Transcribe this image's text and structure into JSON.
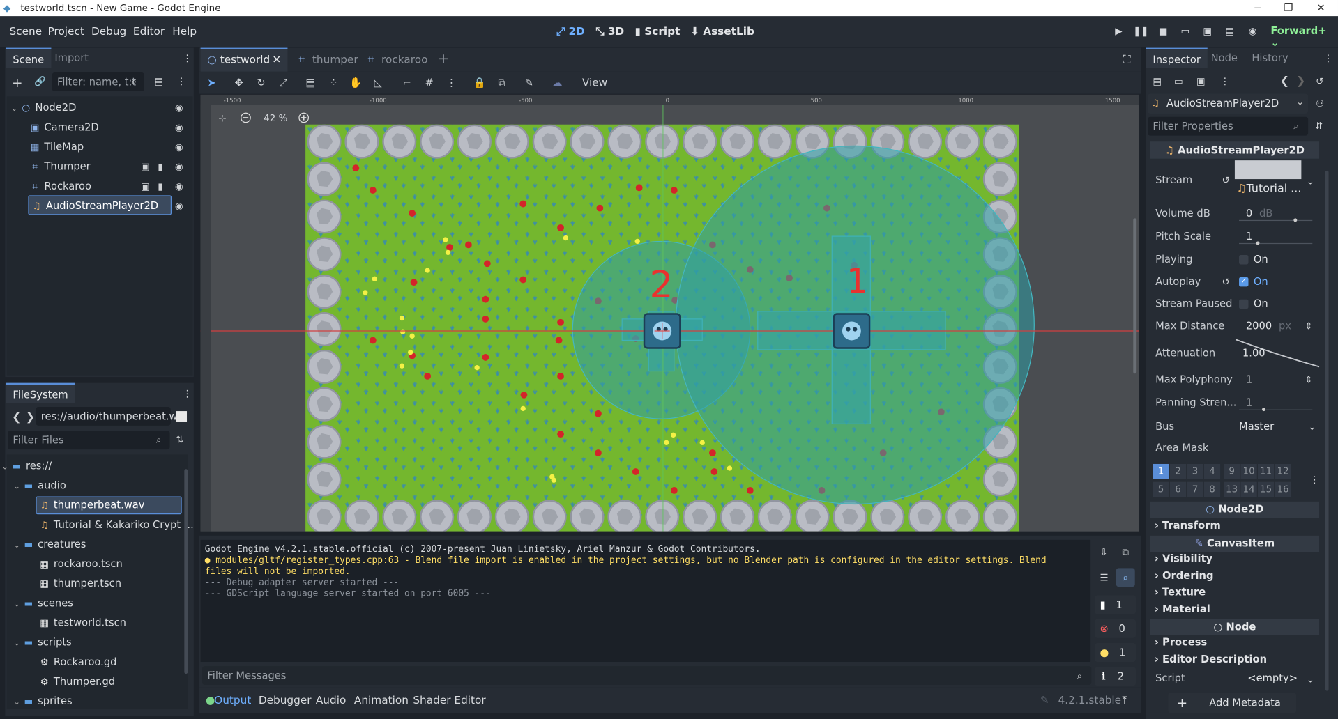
{
  "window": {
    "title": "testworld.tscn - New Game - Godot Engine",
    "minimize": "−",
    "maximize": "❐",
    "close": "✕"
  },
  "menu": [
    "Scene",
    "Project",
    "Debug",
    "Editor",
    "Help"
  ],
  "workspaces": {
    "w2d": "2D",
    "w3d": "3D",
    "script": "Script",
    "assetlib": "AssetLib"
  },
  "renderer": "Forward+",
  "scene_dock": {
    "tabs": [
      "Scene",
      "Import"
    ],
    "filter_placeholder": "Filter: name, t:t",
    "nodes": [
      {
        "label": "Node2D",
        "icon": "○"
      },
      {
        "label": "Camera2D",
        "icon": "▣"
      },
      {
        "label": "TileMap",
        "icon": "▦"
      },
      {
        "label": "Thumper",
        "icon": "⌗"
      },
      {
        "label": "Rockaroo",
        "icon": "⌗"
      },
      {
        "label": "AudioStreamPlayer2D",
        "icon": "♫"
      }
    ]
  },
  "filesystem": {
    "tab": "FileSystem",
    "path": "res://audio/thumperbeat.w",
    "filter_placeholder": "Filter Files",
    "items": [
      {
        "label": "res://",
        "kind": "folder"
      },
      {
        "label": "audio",
        "kind": "folder"
      },
      {
        "label": "thumperbeat.wav",
        "kind": "audio"
      },
      {
        "label": "Tutorial & Kakariko Crypt ...",
        "kind": "audio"
      },
      {
        "label": "creatures",
        "kind": "folder"
      },
      {
        "label": "rockaroo.tscn",
        "kind": "scene"
      },
      {
        "label": "thumper.tscn",
        "kind": "scene"
      },
      {
        "label": "scenes",
        "kind": "folder"
      },
      {
        "label": "testworld.tscn",
        "kind": "scene"
      },
      {
        "label": "scripts",
        "kind": "folder"
      },
      {
        "label": "Rockaroo.gd",
        "kind": "script"
      },
      {
        "label": "Thumper.gd",
        "kind": "script"
      },
      {
        "label": "sprites",
        "kind": "folder"
      }
    ]
  },
  "scene_tabs": [
    "testworld",
    "thumper",
    "rockaroo"
  ],
  "view_menu": "View",
  "zoom": "42 %",
  "ruler_labels": [
    "-1500",
    "-1000",
    "-500",
    "0",
    "500",
    "1000",
    "1500"
  ],
  "annotations": {
    "two": "2",
    "one": "1"
  },
  "output": {
    "lines": [
      {
        "text": "Godot Engine v4.2.1.stable.official (c) 2007-present Juan Linietsky, Ariel Manzur & Godot Contributors.",
        "kind": "normal"
      },
      {
        "text": "● modules/gltf/register_types.cpp:63 - Blend file import is enabled in the project settings, but no Blender path is configured in the editor settings. Blend",
        "kind": "warn"
      },
      {
        "text": "files will not be imported.",
        "kind": "warn"
      },
      {
        "text": "--- Debug adapter server started ---",
        "kind": "dim"
      },
      {
        "text": "--- GDScript language server started on port 6005 ---",
        "kind": "dim"
      }
    ],
    "filter_placeholder": "Filter Messages",
    "counts": {
      "messages": "1",
      "errors": "0",
      "warnings": "1",
      "info": "2"
    }
  },
  "bottom_tabs": [
    "Output",
    "Debugger",
    "Audio",
    "Animation",
    "Shader Editor"
  ],
  "version": "4.2.1.stable",
  "inspector": {
    "tabs": [
      "Inspector",
      "Node",
      "History"
    ],
    "object": "AudioStreamPlayer2D",
    "filter_placeholder": "Filter Properties",
    "class_header": "AudioStreamPlayer2D",
    "props": {
      "stream_label": "Stream",
      "stream_value": "Tutorial ...",
      "volume_label": "Volume dB",
      "volume_value": "0",
      "volume_unit": "dB",
      "pitch_label": "Pitch Scale",
      "pitch_value": "1",
      "playing_label": "Playing",
      "playing_value": "On",
      "autoplay_label": "Autoplay",
      "autoplay_value": "On",
      "paused_label": "Stream Paused",
      "paused_value": "On",
      "maxdist_label": "Max Distance",
      "maxdist_value": "2000",
      "maxdist_unit": "px",
      "atten_label": "Attenuation",
      "atten_value": "1.00",
      "poly_label": "Max Polyphony",
      "poly_value": "1",
      "panning_label": "Panning Stren...",
      "panning_value": "1",
      "bus_label": "Bus",
      "bus_value": "Master",
      "mask_label": "Area Mask"
    },
    "mask_bits": [
      "1",
      "2",
      "3",
      "4",
      "9",
      "10",
      "11",
      "12",
      "5",
      "6",
      "7",
      "8",
      "13",
      "14",
      "15",
      "16"
    ],
    "sections": {
      "node2d": "Node2D",
      "canvasitem": "CanvasItem",
      "node": "Node"
    },
    "groups": {
      "transform": "Transform",
      "visibility": "Visibility",
      "ordering": "Ordering",
      "texture": "Texture",
      "material": "Material",
      "process": "Process",
      "editor_desc": "Editor Description"
    },
    "script_label": "Script",
    "script_value": "<empty>",
    "add_metadata": "Add Metadata"
  },
  "colors": {
    "accent": "#5a8ed8",
    "grass": "#74b72e",
    "area": "#2f9fa6",
    "warning": "#ffde66"
  }
}
